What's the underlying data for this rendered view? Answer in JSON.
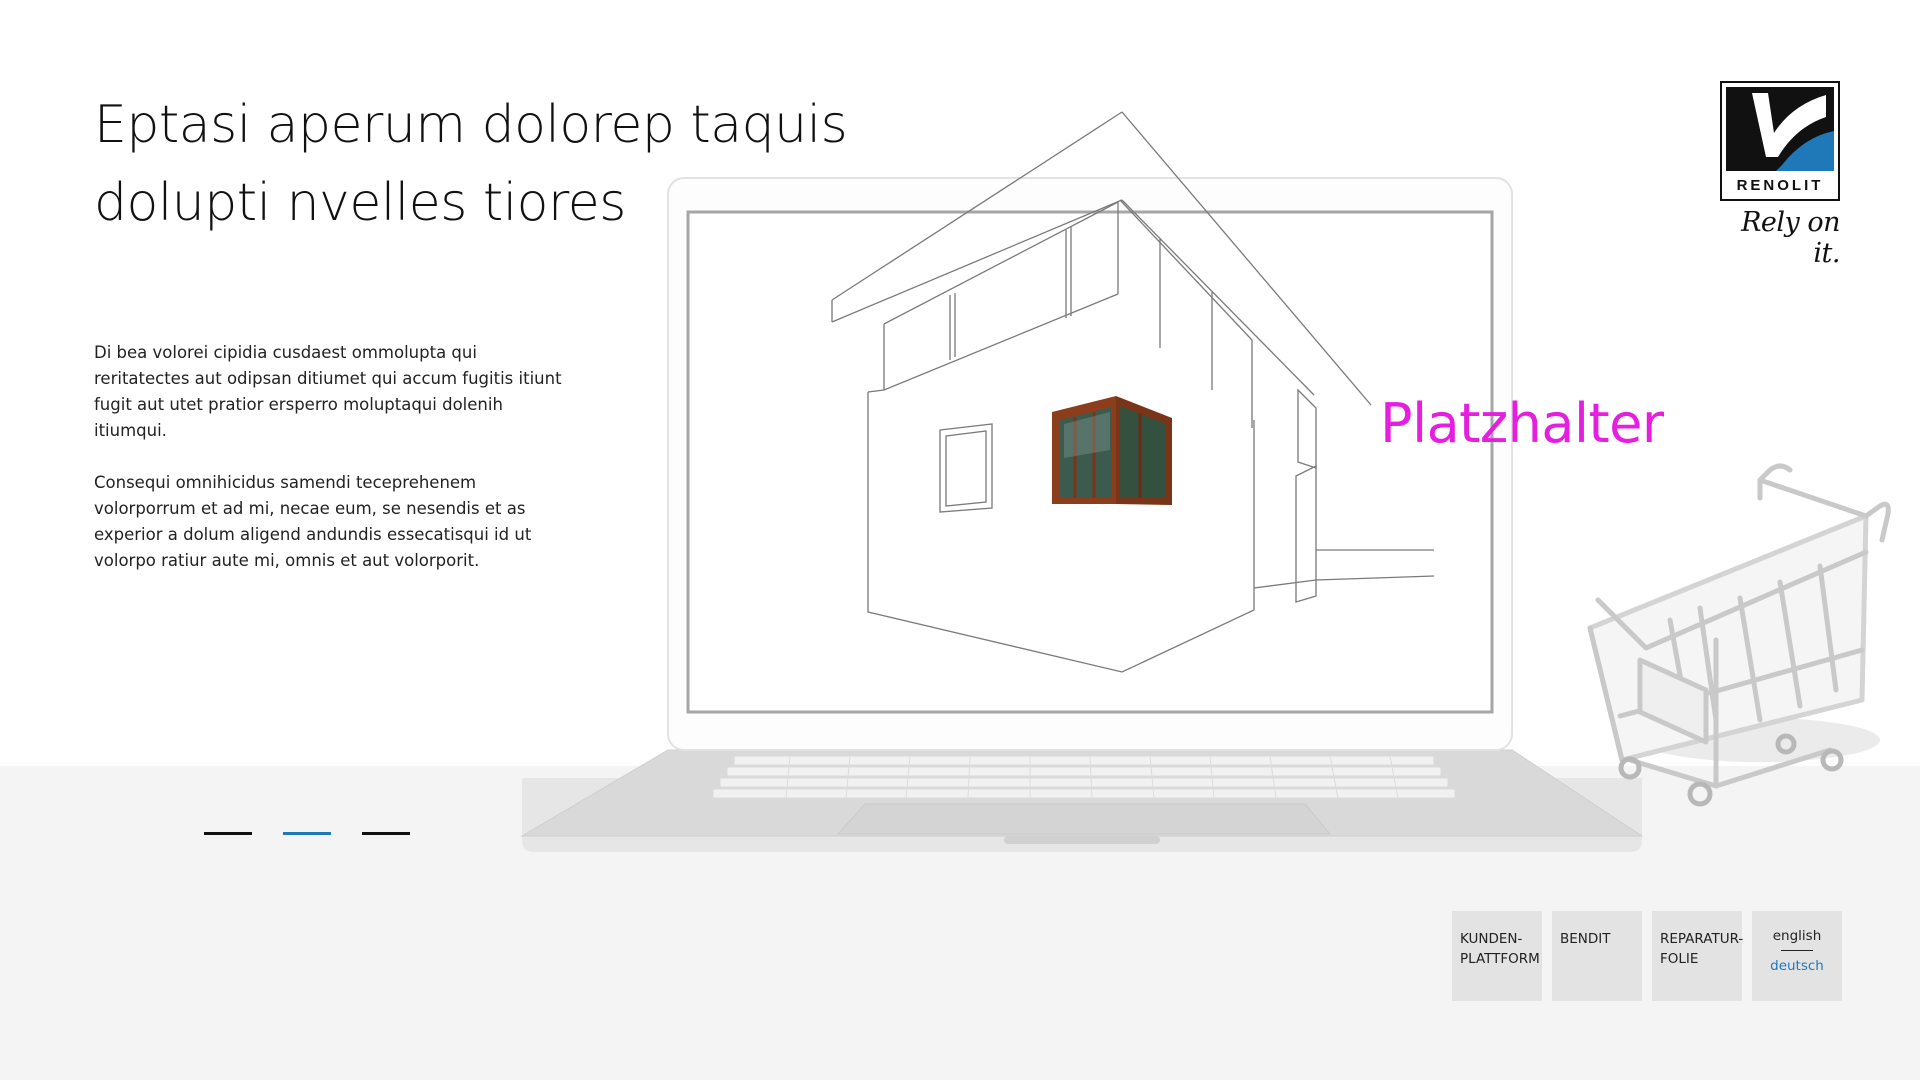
{
  "headline": {
    "line1": "Eptasi aperum dolorep taquis",
    "line2": "dolupti nvelles tiores"
  },
  "body": {
    "paragraph1": "Di bea volorei cipidia cusdaest ommolupta qui reritatectes aut odipsan ditiumet qui accum fugitis itiunt fugit aut utet pratior ersperro moluptaqui dolenih itiumqui.",
    "paragraph2": "Consequi omnihicidus samendi teceprehenem volorporrum et ad mi, necae eum, se nesendis et as experior a dolum aligend andundis essecatisqui id ut volorpo ratiur aute mi, omnis et aut volorporit."
  },
  "placeholder_label": "Platzhalter",
  "slider": {
    "count": 3,
    "active_index": 1
  },
  "brand": {
    "name": "RENOLIT",
    "slogan": "Rely on it."
  },
  "nav": {
    "tiles": [
      {
        "line1": "KUNDEN-",
        "line2": "PLATTFORM"
      },
      {
        "line1": "BENDIT",
        "line2": ""
      },
      {
        "line1": "REPARATUR-",
        "line2": "FOLIE"
      }
    ],
    "language": {
      "english": "english",
      "german": "deutsch",
      "active": "deutsch"
    }
  },
  "colors": {
    "accent_blue": "#1f78b8",
    "placeholder_magenta": "#e61ee0",
    "tile_gray": "#e3e3e3",
    "floor_gray": "#f4f4f4",
    "text": "#111111"
  },
  "icons": {
    "logo": "renolit-logo-icon",
    "cart": "shopping-cart-icon",
    "laptop": "laptop-icon",
    "house": "house-sketch-icon"
  }
}
